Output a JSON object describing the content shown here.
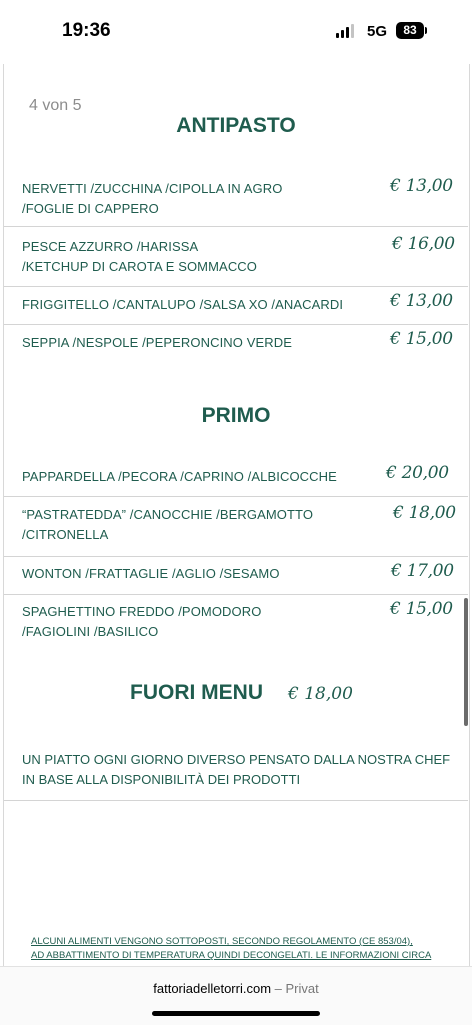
{
  "status": {
    "time": "19:36",
    "network": "5G",
    "battery": "83"
  },
  "pager": "4 von 5",
  "antipasto": {
    "title": "ANTIPASTO",
    "items": [
      {
        "line1": "NERVETTI /ZUCCHINA /CIPOLLA IN AGRO",
        "line2": "/FOGLIE DI CAPPERO",
        "price": "€ 13,00"
      },
      {
        "line1": "PESCE AZZURRO /HARISSA",
        "line2": "/KETCHUP DI CAROTA E SOMMACCO",
        "price": "€ 16,00"
      },
      {
        "line1": "FRIGGITELLO /CANTALUPO /SALSA XO /ANACARDI",
        "line2": "",
        "price": "€ 13,00"
      },
      {
        "line1": "SEPPIA /NESPOLE /PEPERONCINO VERDE",
        "line2": "",
        "price": "€ 15,00"
      }
    ]
  },
  "primo": {
    "title": "PRIMO",
    "items": [
      {
        "line1": "PAPPARDELLA /PECORA /CAPRINO /ALBICOCCHE",
        "line2": "",
        "price": "€ 20,00"
      },
      {
        "line1": "“PASTRATEDDA” /CANOCCHIE /BERGAMOTTO",
        "line2": "/CITRONELLA",
        "price": "€ 18,00"
      },
      {
        "line1": "WONTON /FRATTAGLIE /AGLIO /SESAMO",
        "line2": "",
        "price": "€ 17,00"
      },
      {
        "line1": "SPAGHETTINO FREDDO /POMODORO",
        "line2": "/FAGIOLINI /BASILICO",
        "price": "€ 15,00"
      }
    ]
  },
  "fuori": {
    "title": "FUORI MENU",
    "price": "€ 18,00",
    "desc_line1": "UN PIATTO OGNI GIORNO DIVERSO PENSATO DALLA NOSTRA CHEF",
    "desc_line2": "IN BASE ALLA DISPONIBILITÀ DEI PRODOTTI"
  },
  "footnote": {
    "line1": "ALCUNI ALIMENTI VENGONO SOTTOPOSTI, SECONDO REGOLAMENTO (CE 853/04),",
    "line2": "AD ABBATTIMENTO DI TEMPERATURA QUINDI DECONGELATI. LE INFORMAZIONI CIRCA"
  },
  "browser": {
    "domain": "fattoriadelletorri.com",
    "separator": " – ",
    "mode": "Privat"
  },
  "colors": {
    "brand_green": "#1f5c4e",
    "divider": "#d4d4d4"
  }
}
